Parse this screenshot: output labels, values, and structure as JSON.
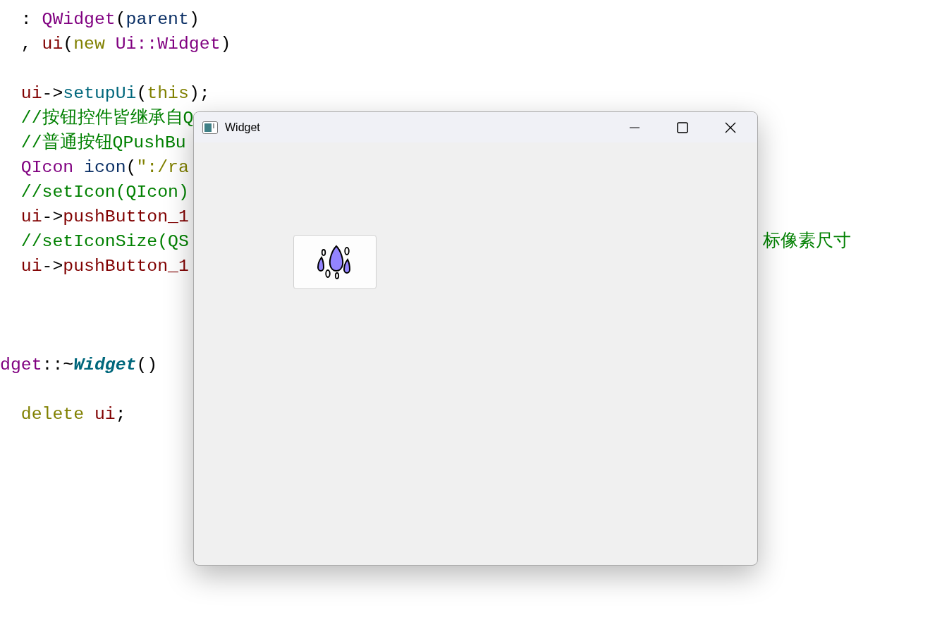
{
  "editor": {
    "lines": [
      {
        "kind": "code",
        "indented": true,
        "tokens": [
          {
            "text": ": ",
            "kind": "plain"
          },
          {
            "text": "QWidget",
            "kind": "type"
          },
          {
            "text": "(",
            "kind": "plain"
          },
          {
            "text": "parent",
            "kind": "param"
          },
          {
            "text": ")",
            "kind": "plain"
          }
        ]
      },
      {
        "kind": "code",
        "indented": true,
        "tokens": [
          {
            "text": ", ",
            "kind": "plain"
          },
          {
            "text": "ui",
            "kind": "member"
          },
          {
            "text": "(",
            "kind": "plain"
          },
          {
            "text": "new",
            "kind": "keyword"
          },
          {
            "text": " Ui::Widget",
            "kind": "type"
          },
          {
            "text": ")",
            "kind": "plain"
          }
        ]
      },
      {
        "kind": "blank"
      },
      {
        "kind": "code",
        "indented": true,
        "tokens": [
          {
            "text": "ui",
            "kind": "member"
          },
          {
            "text": "->",
            "kind": "plain"
          },
          {
            "text": "setupUi",
            "kind": "func"
          },
          {
            "text": "(",
            "kind": "plain"
          },
          {
            "text": "this",
            "kind": "keyword"
          },
          {
            "text": ");",
            "kind": "plain"
          }
        ]
      },
      {
        "kind": "code",
        "indented": true,
        "tokens": [
          {
            "text": "//按钮控件皆继承自Q",
            "kind": "comment"
          }
        ]
      },
      {
        "kind": "code",
        "indented": true,
        "tokens": [
          {
            "text": "//普通按钮QPushBu",
            "kind": "comment"
          }
        ]
      },
      {
        "kind": "code",
        "indented": true,
        "tokens": [
          {
            "text": "QIcon",
            "kind": "type"
          },
          {
            "text": " icon",
            "kind": "param"
          },
          {
            "text": "(",
            "kind": "plain"
          },
          {
            "text": "\":/ra",
            "kind": "string"
          }
        ]
      },
      {
        "kind": "code",
        "indented": true,
        "tokens": [
          {
            "text": "//setIcon(QIcon)",
            "kind": "comment"
          }
        ]
      },
      {
        "kind": "code",
        "indented": true,
        "tokens": [
          {
            "text": "ui",
            "kind": "member"
          },
          {
            "text": "->",
            "kind": "plain"
          },
          {
            "text": "pushButton_1",
            "kind": "member"
          }
        ]
      },
      {
        "kind": "code",
        "indented": true,
        "tokens": [
          {
            "text": "//setIconSize(QS",
            "kind": "comment"
          }
        ],
        "tail": {
          "text": "标像素尺寸",
          "kind": "comment"
        }
      },
      {
        "kind": "code",
        "indented": true,
        "tokens": [
          {
            "text": "ui",
            "kind": "member"
          },
          {
            "text": "->",
            "kind": "plain"
          },
          {
            "text": "pushButton_1",
            "kind": "member"
          }
        ]
      },
      {
        "kind": "blank"
      },
      {
        "kind": "blank"
      },
      {
        "kind": "blank"
      },
      {
        "kind": "code",
        "indented": false,
        "tokens": [
          {
            "text": "dget",
            "kind": "type"
          },
          {
            "text": "::~",
            "kind": "plain"
          },
          {
            "text": "Widget",
            "kind": "funcdef"
          },
          {
            "text": "()",
            "kind": "plain"
          }
        ]
      },
      {
        "kind": "blank"
      },
      {
        "kind": "code",
        "indented": true,
        "tokens": [
          {
            "text": "delete",
            "kind": "keyword"
          },
          {
            "text": " ui",
            "kind": "member"
          },
          {
            "text": ";",
            "kind": "plain"
          }
        ]
      }
    ]
  },
  "window": {
    "title": "Widget",
    "buttons": [
      {
        "kind": "icon"
      }
    ]
  }
}
